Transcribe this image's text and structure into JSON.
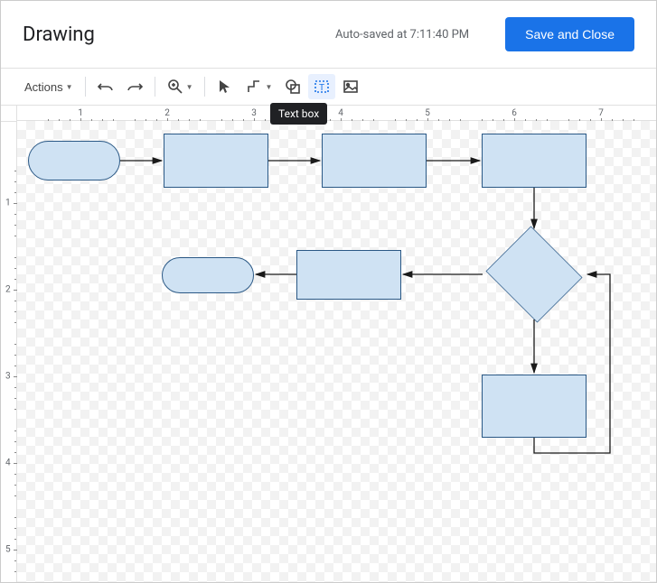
{
  "header": {
    "title": "Drawing",
    "autosave": "Auto-saved at 7:11:40 PM",
    "save_label": "Save and Close"
  },
  "toolbar": {
    "actions_label": "Actions"
  },
  "tooltip": {
    "text": "Text box"
  },
  "ruler": {
    "h": [
      "1",
      "2",
      "3",
      "4",
      "5",
      "6",
      "7"
    ],
    "v": [
      "1",
      "2",
      "3",
      "4",
      "5"
    ]
  },
  "shapes": [
    {
      "id": "start",
      "type": "rounded-rect"
    },
    {
      "id": "process-1",
      "type": "rect"
    },
    {
      "id": "process-2",
      "type": "rect"
    },
    {
      "id": "process-3",
      "type": "rect"
    },
    {
      "id": "decision",
      "type": "diamond"
    },
    {
      "id": "process-4",
      "type": "rect"
    },
    {
      "id": "end",
      "type": "rounded-rect"
    },
    {
      "id": "process-5",
      "type": "rect"
    }
  ],
  "connectors": [
    {
      "from": "start",
      "to": "process-1"
    },
    {
      "from": "process-1",
      "to": "process-2"
    },
    {
      "from": "process-2",
      "to": "process-3"
    },
    {
      "from": "process-3",
      "to": "decision"
    },
    {
      "from": "decision",
      "to": "process-4"
    },
    {
      "from": "process-4",
      "to": "end"
    },
    {
      "from": "decision",
      "to": "process-5"
    },
    {
      "from": "process-5",
      "to": "decision",
      "route": "loop-back"
    }
  ]
}
